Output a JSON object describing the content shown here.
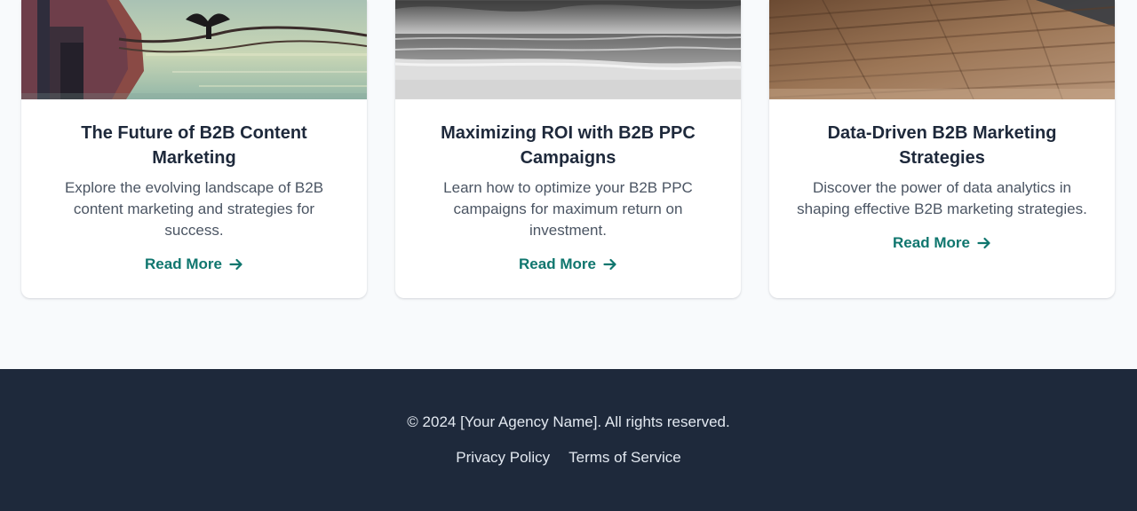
{
  "cards": [
    {
      "image_icon": "harbor-bird-photo",
      "title": "The Future of B2B Content Marketing",
      "description": "Explore the evolving landscape of B2B content marketing and strategies for success.",
      "link_label": "Read More",
      "link_icon": "arrow-right-icon"
    },
    {
      "image_icon": "beach-seascape-photo",
      "title": "Maximizing ROI with B2B PPC Campaigns",
      "description": "Learn how to optimize your B2B PPC campaigns for maximum return on investment.",
      "link_label": "Read More",
      "link_icon": "arrow-right-icon"
    },
    {
      "image_icon": "wooden-deck-photo",
      "title": "Data-Driven B2B Marketing Strategies",
      "description": "Discover the power of data analytics in shaping effective B2B marketing strategies.",
      "link_label": "Read More",
      "link_icon": "arrow-right-icon"
    }
  ],
  "footer": {
    "copyright": "© 2024 [Your Agency Name]. All rights reserved.",
    "links": [
      "Privacy Policy",
      "Terms of Service"
    ]
  },
  "colors": {
    "page_background": "#f8fafc",
    "card_background": "#ffffff",
    "title_text": "#1e293b",
    "body_text": "#4b5563",
    "accent_link": "#0f766e",
    "footer_background": "#1e293b",
    "footer_text": "#e2e8f0"
  }
}
